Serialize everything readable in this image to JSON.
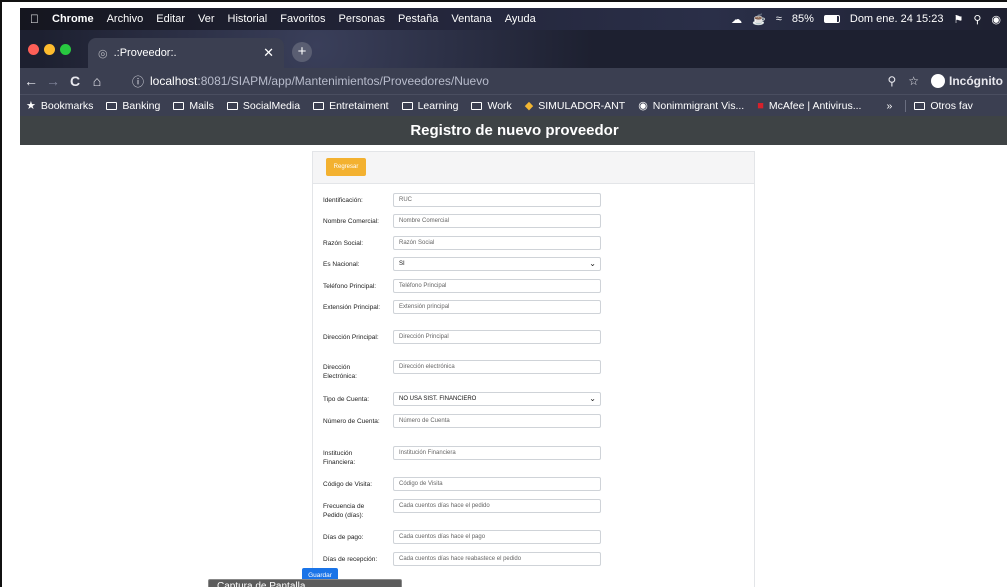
{
  "menubar": {
    "apple_icon": "apple-logo-icon",
    "items": [
      "Chrome",
      "Archivo",
      "Editar",
      "Ver",
      "Historial",
      "Favoritos",
      "Personas",
      "Pestaña",
      "Ventana",
      "Ayuda"
    ],
    "battery": "85%",
    "clock": "Dom ene. 24  15:23"
  },
  "browser": {
    "tab_title": ".:Proveedor:.",
    "url_host": "localhost",
    "url_path": ":8081/SIAPM/app/Mantenimientos/Proveedores/Nuevo",
    "incognito_label": "Incógnito",
    "bookmarks": [
      {
        "label": "Bookmarks",
        "icon": "star-icon"
      },
      {
        "label": "Banking",
        "icon": "folder-icon"
      },
      {
        "label": "Mails",
        "icon": "folder-icon"
      },
      {
        "label": "SocialMedia",
        "icon": "folder-icon"
      },
      {
        "label": "Entretaiment",
        "icon": "folder-icon"
      },
      {
        "label": "Learning",
        "icon": "folder-icon"
      },
      {
        "label": "Work",
        "icon": "folder-icon"
      },
      {
        "label": "SIMULADOR-ANT",
        "icon": "site-icon"
      },
      {
        "label": "Nonimmigrant Vis...",
        "icon": "site-icon"
      },
      {
        "label": "McAfee | Antivirus...",
        "icon": "mcafee-icon"
      }
    ],
    "other_bookmarks": "Otros fav"
  },
  "page": {
    "title": "Registro de nuevo proveedor",
    "back_button": "Regresar",
    "save_button": "Guardar",
    "fields": [
      {
        "label": "Identificación:",
        "placeholder": "RUC",
        "kind": "input"
      },
      {
        "label": "Nombre Comercial:",
        "placeholder": "Nombre Comercial",
        "kind": "input"
      },
      {
        "label": "Razón Social:",
        "placeholder": "Razón Social",
        "kind": "input"
      },
      {
        "label": "Es Nacional:",
        "value": "SI",
        "kind": "select"
      },
      {
        "label": "Teléfono Principal:",
        "placeholder": "Teléfono Principal",
        "kind": "input"
      },
      {
        "label": "Extensión Principal:",
        "placeholder": "Extensión principal",
        "kind": "input"
      },
      {
        "label": "Dirección Principal:",
        "placeholder": "Dirección Principal",
        "kind": "input"
      },
      {
        "label": "Dirección Electrónica:",
        "placeholder": "Dirección electrónica",
        "kind": "input"
      },
      {
        "label": "Tipo de Cuenta:",
        "value": "NO USA SIST. FINANCIERO",
        "kind": "select"
      },
      {
        "label": "Número de Cuenta:",
        "placeholder": "Número de Cuenta",
        "kind": "input"
      },
      {
        "label": "Institución Financiera:",
        "placeholder": "Institución Financiera",
        "kind": "input"
      },
      {
        "label": "Código de Visita:",
        "placeholder": "Código de Visita",
        "kind": "input"
      },
      {
        "label": "Frecuencia de Pedido (días):",
        "placeholder": "Cada cuentos días hace el pedido",
        "kind": "input"
      },
      {
        "label": "Días de pago:",
        "placeholder": "Cada cuentos días hace el pago",
        "kind": "input"
      },
      {
        "label": "Días de recepción:",
        "placeholder": "Cada cuentos días hace reabastece el pedido",
        "kind": "input"
      }
    ]
  },
  "tooltip": "Captura de Pantalla",
  "colors": {
    "header_bg": "#3e4345",
    "back_button": "#f3b130",
    "save_button": "#1a74e8"
  }
}
